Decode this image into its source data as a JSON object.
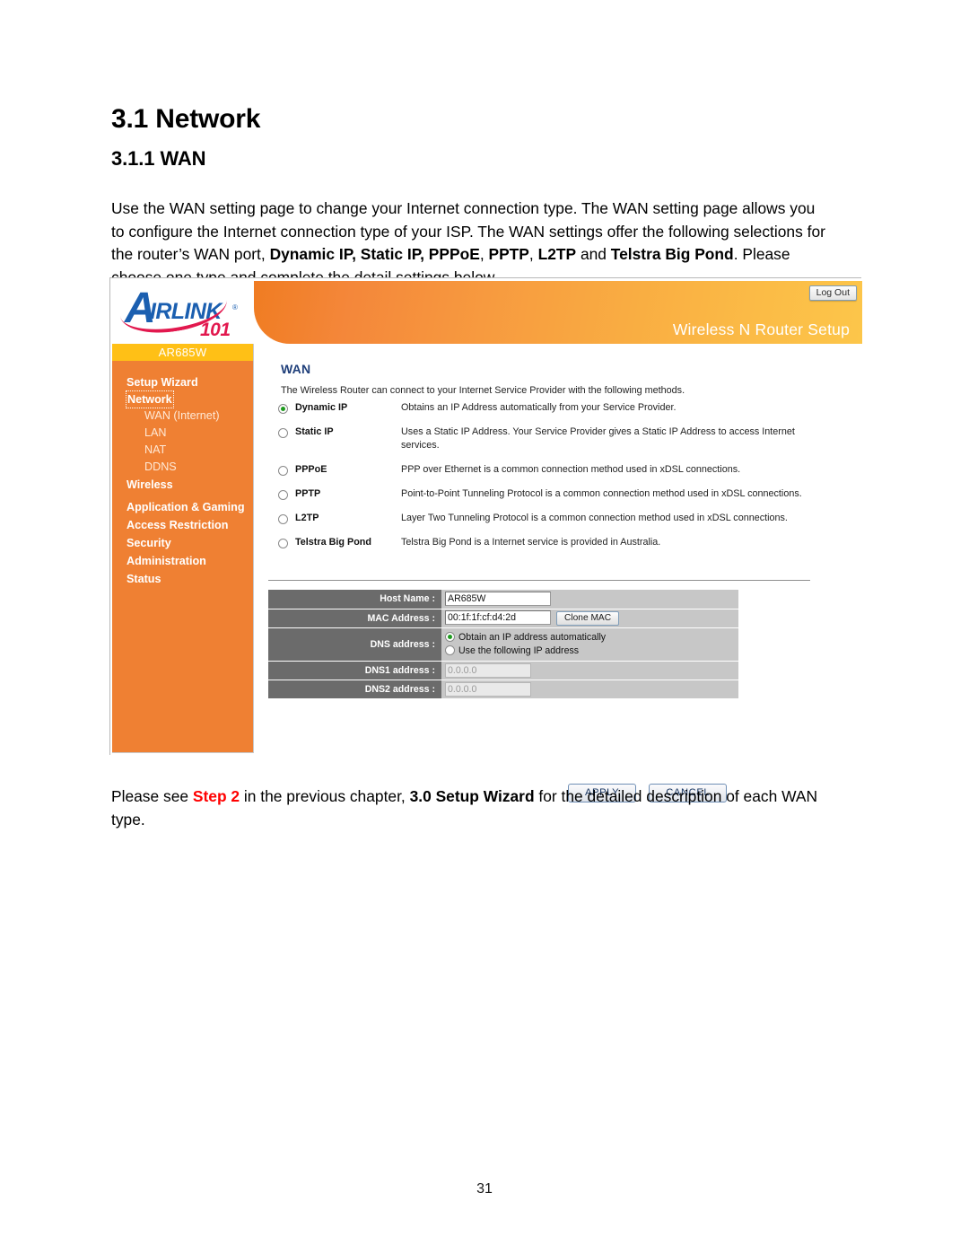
{
  "document": {
    "section_heading": "3.1 Network",
    "sub_heading": "3.1.1 WAN",
    "page_number": "31",
    "intro": {
      "part1": "Use the WAN setting page to change your Internet connection type. The WAN setting page allows you to configure the Internet connection type of your ISP. The WAN settings offer the following selections for the router’s WAN port, ",
      "bold1": "Dynamic IP, Static IP, PPPoE",
      "mid1": ", ",
      "bold2": "PPTP",
      "mid2": ", ",
      "bold3": "L2TP",
      "mid3": " and ",
      "bold4": "Telstra Big Pond",
      "part2": ". Please choose one type and complete the detail settings below."
    },
    "closing": {
      "lead": "Please see ",
      "step": "Step 2",
      "mid": " in the previous chapter, ",
      "bold": "3.0 Setup Wizard",
      "tail": " for the detailed description of each WAN type."
    }
  },
  "router_ui": {
    "logo": {
      "letter": "A",
      "word": "IRL",
      "word2": "INK",
      "registered": "®",
      "number": "101"
    },
    "banner_title": "Wireless N Router Setup",
    "logout_label": "Log Out",
    "model": "AR685W",
    "sidebar": [
      {
        "label": "Setup Wizard",
        "type": "top",
        "selected": false
      },
      {
        "label": "Network",
        "type": "top",
        "selected": true
      },
      {
        "label": "WAN (Internet)",
        "type": "sub",
        "selected": false
      },
      {
        "label": "LAN",
        "type": "sub",
        "selected": false
      },
      {
        "label": "NAT",
        "type": "sub",
        "selected": false
      },
      {
        "label": "DDNS",
        "type": "sub",
        "selected": false
      },
      {
        "label": "Wireless",
        "type": "top",
        "selected": false
      },
      {
        "label": "Application & Gaming",
        "type": "top",
        "selected": false
      },
      {
        "label": "Access Restriction",
        "type": "top",
        "selected": false
      },
      {
        "label": "Security",
        "type": "top",
        "selected": false
      },
      {
        "label": "Administration",
        "type": "top",
        "selected": false
      },
      {
        "label": "Status",
        "type": "top",
        "selected": false
      }
    ],
    "panel": {
      "title": "WAN",
      "description": "The Wireless Router can connect to your Internet Service Provider with the following methods."
    },
    "connection_types": [
      {
        "name": "Dynamic IP",
        "description": "Obtains an IP Address automatically from your Service Provider.",
        "selected": true
      },
      {
        "name": "Static IP",
        "description": "Uses a Static IP Address. Your Service Provider gives a Static IP Address to access Internet services.",
        "selected": false
      },
      {
        "name": "PPPoE",
        "description": "PPP over Ethernet is a common connection method used in xDSL connections.",
        "selected": false
      },
      {
        "name": "PPTP",
        "description": "Point-to-Point Tunneling Protocol is a common connection method used in xDSL connections.",
        "selected": false
      },
      {
        "name": "L2TP",
        "description": "Layer Two Tunneling Protocol is a common connection method used in xDSL connections.",
        "selected": false
      },
      {
        "name": "Telstra Big Pond",
        "description": "Telstra Big Pond is a Internet service is provided in Australia.",
        "selected": false
      }
    ],
    "settings": {
      "host_name_label": "Host Name :",
      "host_name_value": "AR685W",
      "mac_address_label": "MAC Address :",
      "mac_address_value": "00:1f:1f:cf:d4:2d",
      "clone_mac_label": "Clone MAC",
      "dns_address_label": "DNS address :",
      "dns_option_auto": "Obtain an IP address automatically",
      "dns_option_manual": "Use the following IP address",
      "dns_auto_selected": true,
      "dns1_label": "DNS1 address :",
      "dns1_value": "0.0.0.0",
      "dns2_label": "DNS2 address :",
      "dns2_value": "0.0.0.0"
    },
    "buttons": {
      "apply": "APPLY",
      "cancel": "CANCEL"
    },
    "colors": {
      "banner_left": "#f07c22",
      "banner_right": "#fcc64a",
      "sidebar": "#ef8033",
      "model_bar": "#ffc016",
      "panel_title": "#1f3f7a",
      "label_cell": "#6b6b6b",
      "value_cell": "#c7c7c7",
      "radio_dot": "#1f9b1f",
      "logo_blue": "#1b5fb0",
      "logo_red": "#e2184e",
      "step_red": "#ff0000"
    }
  }
}
